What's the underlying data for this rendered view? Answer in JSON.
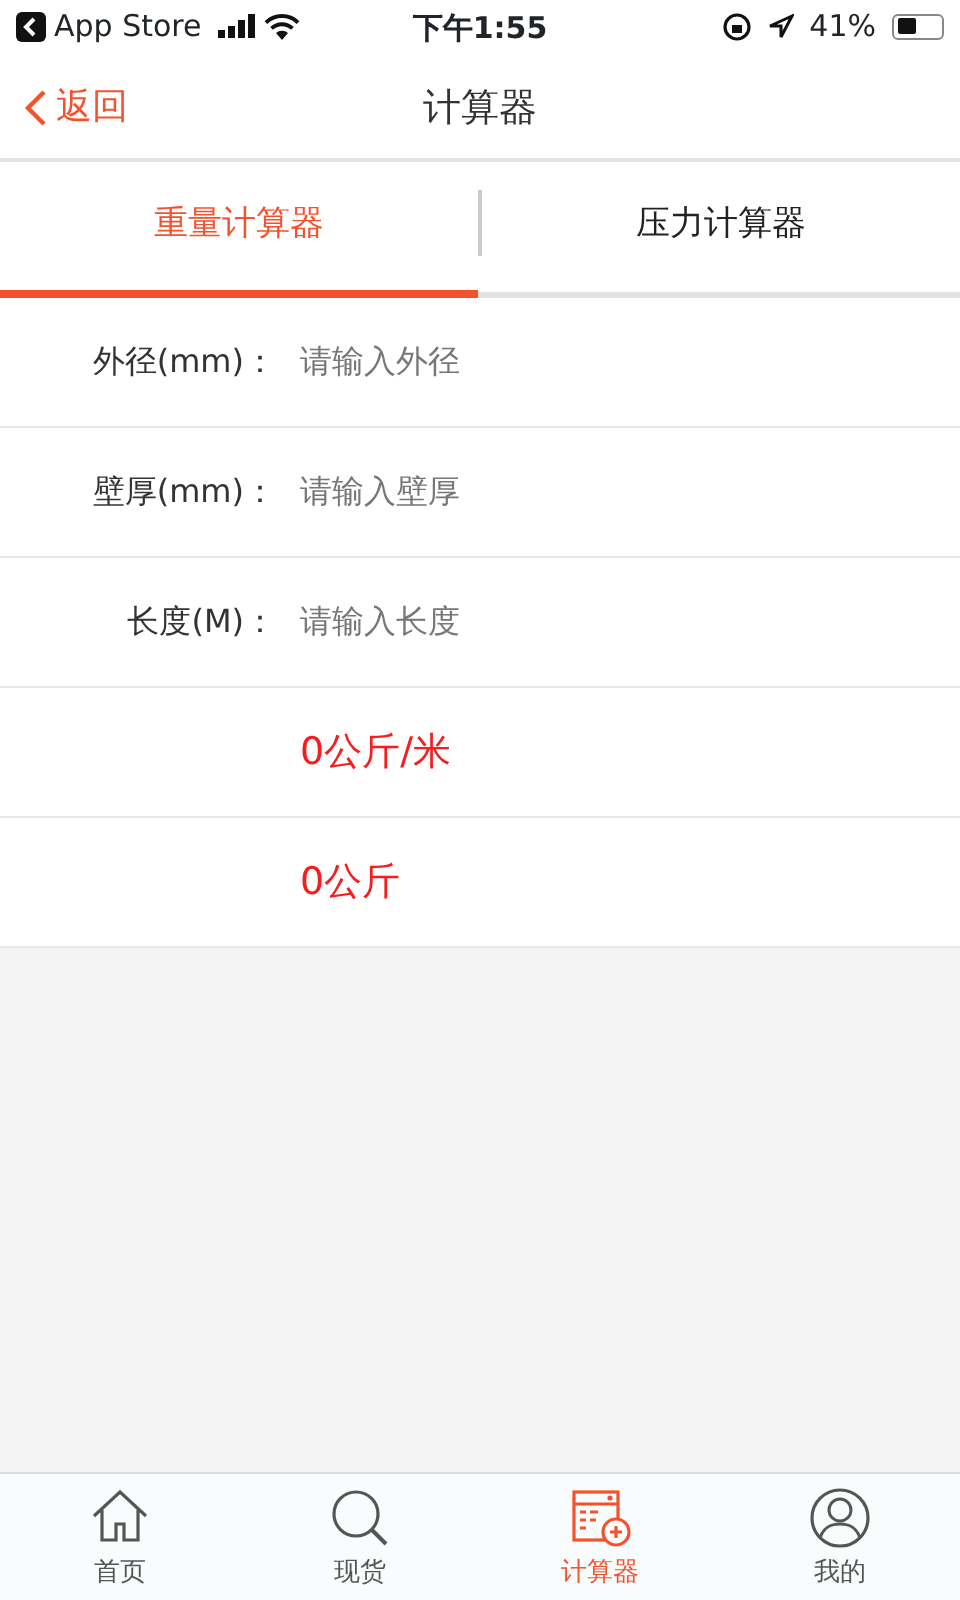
{
  "status_bar": {
    "back_app": "App Store",
    "time": "下午1:55",
    "battery": "41%"
  },
  "nav": {
    "back": "返回",
    "title": "计算器"
  },
  "tabs": [
    {
      "label": "重量计算器",
      "selected": true
    },
    {
      "label": "压力计算器",
      "selected": false
    }
  ],
  "rows": [
    {
      "kind": "input",
      "label": "外径(mm)：",
      "placeholder": "请输入外径"
    },
    {
      "kind": "input",
      "label": "壁厚(mm)：",
      "placeholder": "请输入壁厚"
    },
    {
      "kind": "input",
      "label": "长度(M)：",
      "placeholder": "请输入长度"
    },
    {
      "kind": "result",
      "value": "0公斤/米"
    },
    {
      "kind": "result",
      "value": "0公斤"
    }
  ],
  "tab_bar": [
    {
      "kind": "home",
      "label": "首页",
      "selected": false
    },
    {
      "kind": "search",
      "label": "现货",
      "selected": false
    },
    {
      "kind": "calculator",
      "label": "计算器",
      "selected": true
    },
    {
      "kind": "profile",
      "label": "我的",
      "selected": false
    }
  ]
}
